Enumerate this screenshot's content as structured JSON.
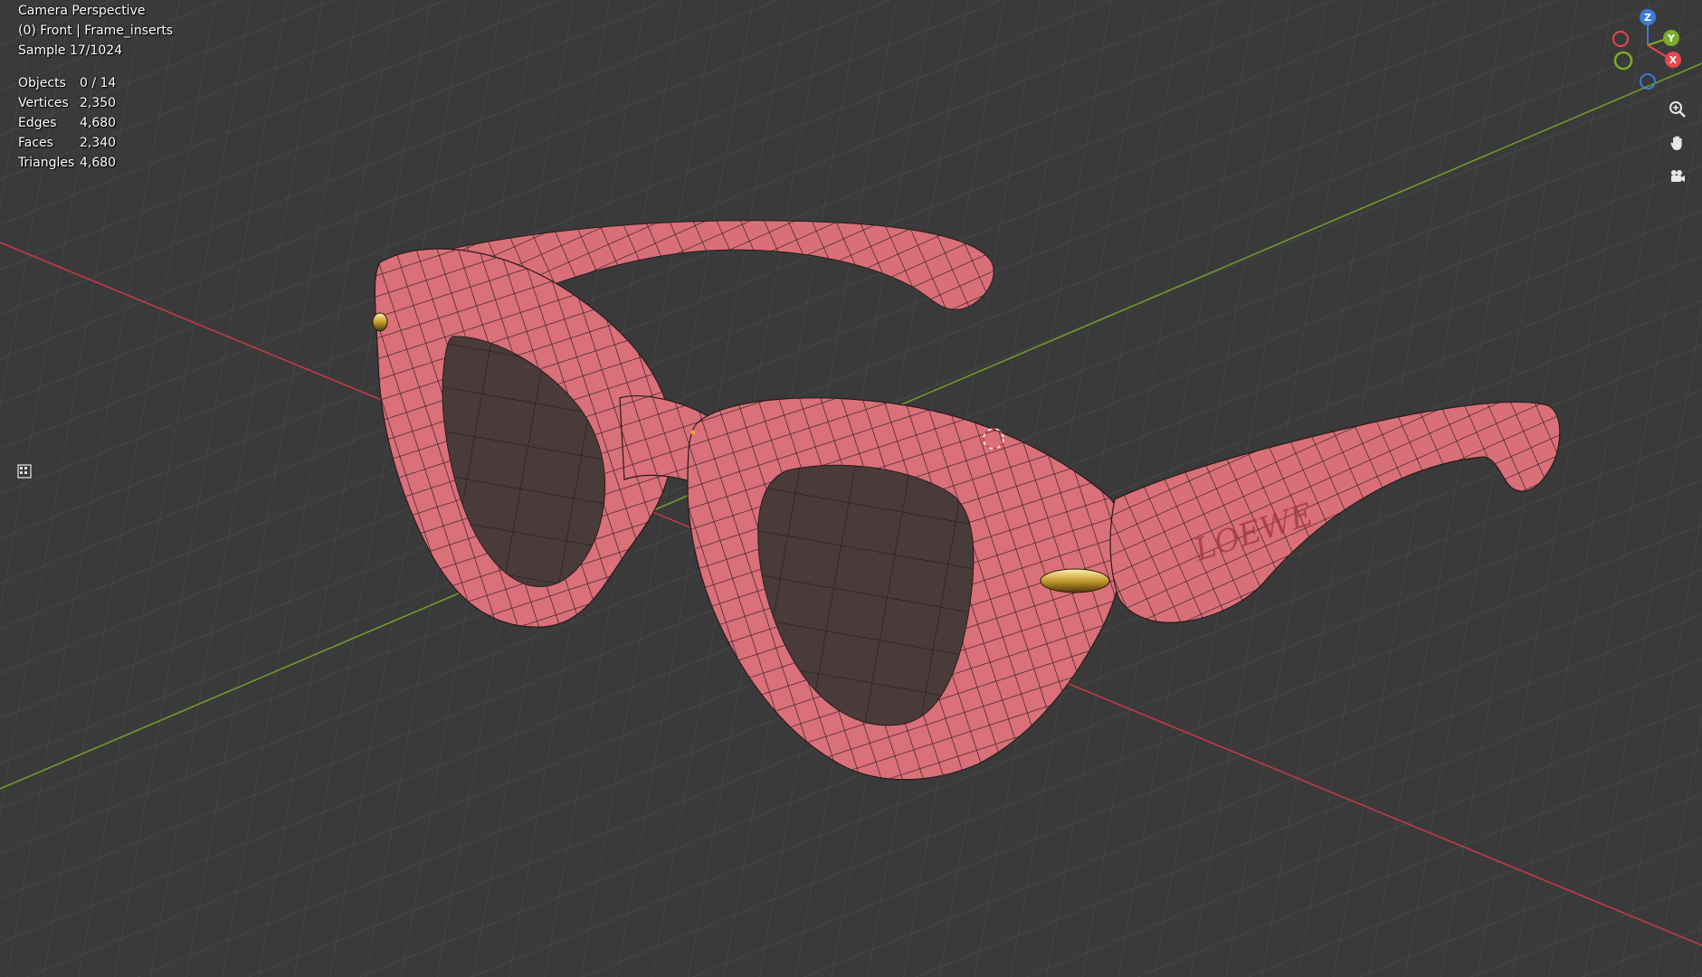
{
  "viewport": {
    "view_name": "Camera Perspective",
    "collection_info": "(0) Front | Frame_inserts",
    "render_sample": "Sample 17/1024"
  },
  "stats": [
    {
      "label": "Objects",
      "value": "0 / 14"
    },
    {
      "label": "Vertices",
      "value": "2,350"
    },
    {
      "label": "Edges",
      "value": "4,680"
    },
    {
      "label": "Faces",
      "value": "2,340"
    },
    {
      "label": "Triangles",
      "value": "4,680"
    }
  ],
  "gizmo": {
    "axes": [
      {
        "name": "Z",
        "color": "#3d7bd9"
      },
      {
        "name": "Y",
        "color": "#7cab2a"
      },
      {
        "name": "X",
        "color": "#e8454d"
      }
    ]
  },
  "nav_buttons": {
    "zoom_icon": "zoom-icon",
    "pan_icon": "hand-icon",
    "camera_icon": "camera-icon"
  },
  "scene": {
    "brand_text": "LOEWE",
    "frame_color": "#d9707a",
    "lens_color": "#4b3d3d",
    "floor_color": "#3a3a3a",
    "x_axis_color": "#c23a45",
    "y_axis_color": "#6f9b2c"
  }
}
